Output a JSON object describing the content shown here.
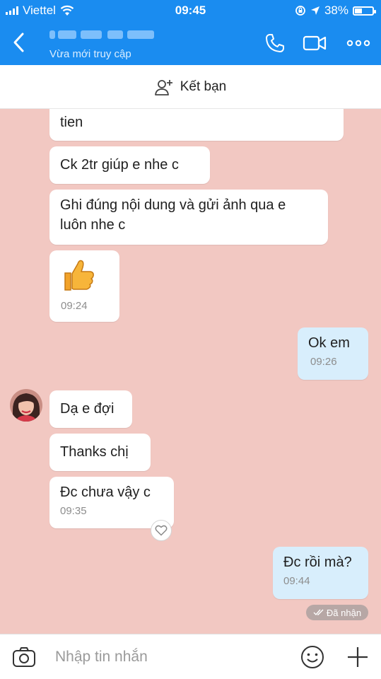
{
  "status_bar": {
    "carrier": "Viettel",
    "time": "09:45",
    "battery": "38%",
    "battery_level": 0.38
  },
  "header": {
    "status": "Vừa mới truy cập"
  },
  "friend_bar": {
    "label": "Kết bạn"
  },
  "messages": [
    {
      "from": "them",
      "text": "tien"
    },
    {
      "from": "them",
      "text": "Ck 2tr giúp e nhe c"
    },
    {
      "from": "them",
      "text_line1": "Ghi đúng nội dung và gửi ảnh qua e",
      "text_line2": "luôn nhe c"
    },
    {
      "from": "them",
      "sticker": "thumbs-up",
      "time": "09:24"
    },
    {
      "from": "me",
      "text": "Ok em",
      "time": "09:26"
    },
    {
      "from": "them",
      "text": "Dạ e đợi"
    },
    {
      "from": "them",
      "text": "Thanks chị"
    },
    {
      "from": "them",
      "text": "Đc chưa vậy c",
      "time": "09:35"
    },
    {
      "from": "me",
      "text": "Đc rồi mà?",
      "time": "09:44"
    }
  ],
  "delivery_status": "Đã nhận",
  "input": {
    "placeholder": "Nhập tin nhắn"
  },
  "colors": {
    "header_blue": "#1a8cf0",
    "chat_background": "#f2c8c2",
    "my_bubble": "#d8eefc"
  }
}
